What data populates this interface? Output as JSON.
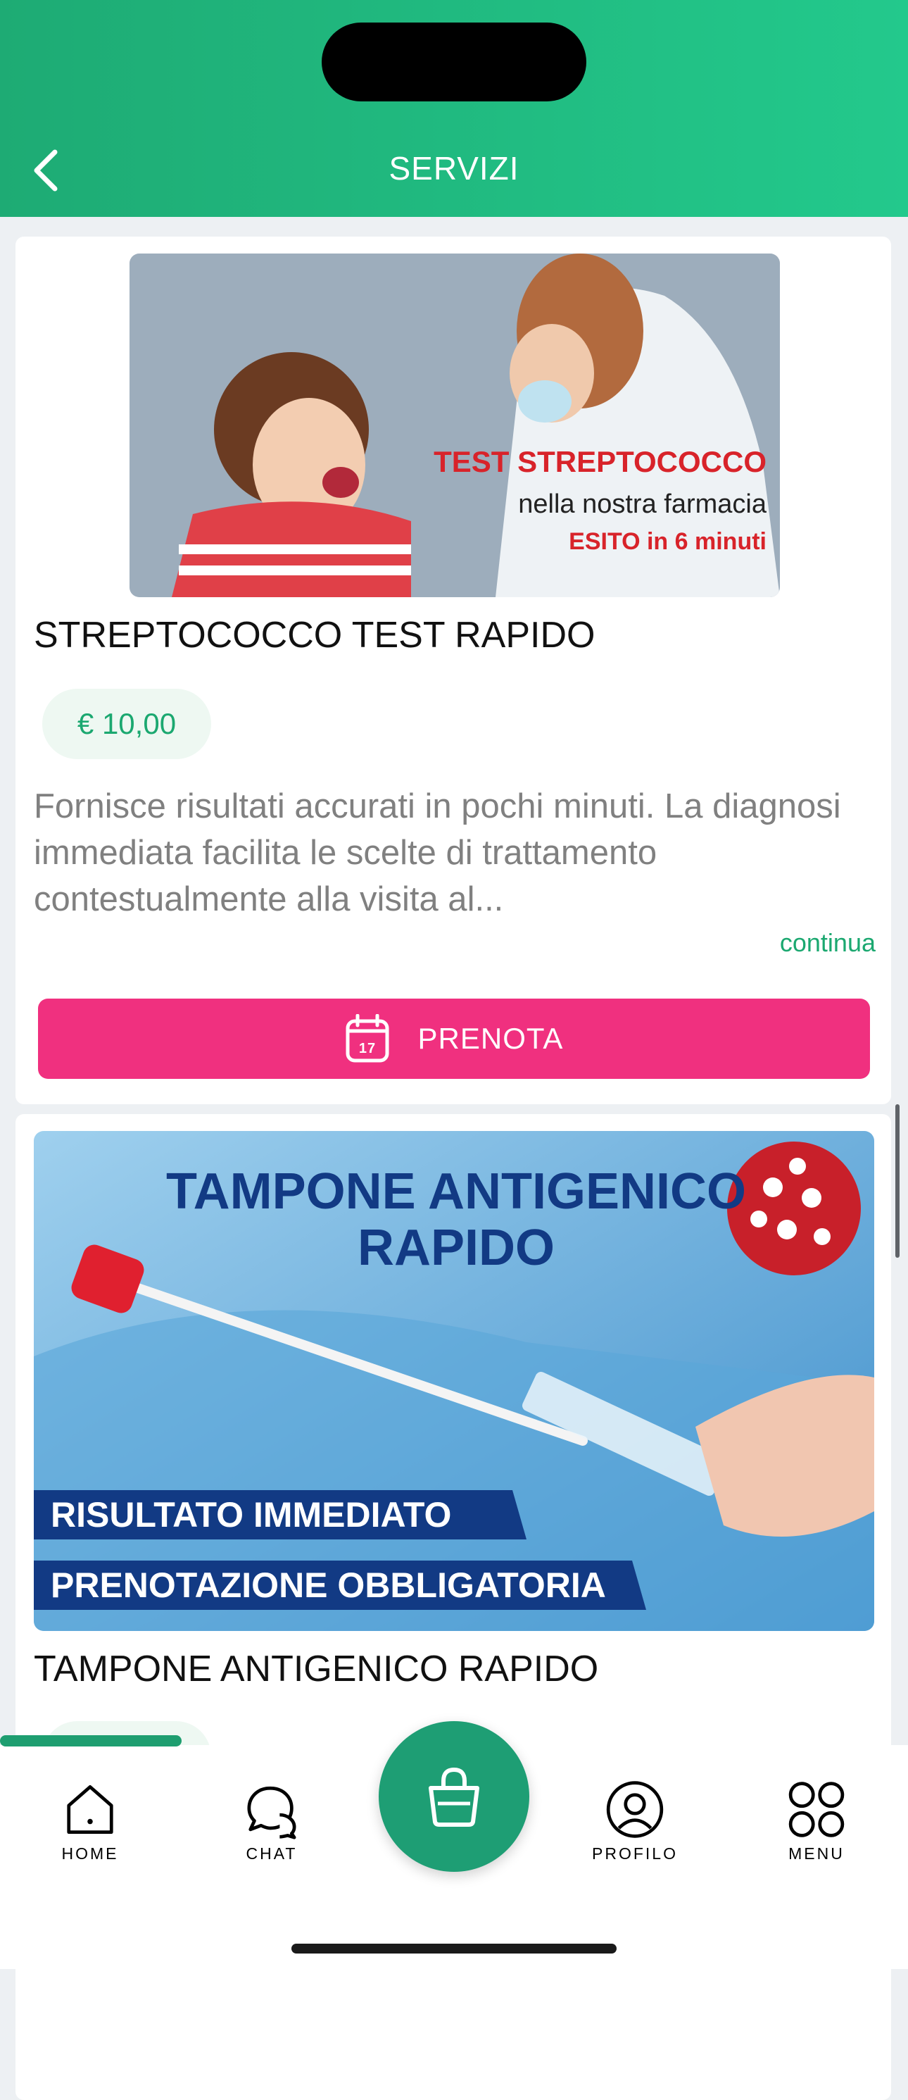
{
  "header": {
    "title": "SERVIZI",
    "back_icon": "chevron-left-icon"
  },
  "services": [
    {
      "title": "STREPTOCOCCO TEST RAPIDO",
      "price": "€ 10,00",
      "description": "Fornisce risultati accurati in pochi minuti. La diagnosi immediata facilita le scelte di trattamento contestualmente alla visita al...",
      "continue_label": "continua",
      "book_label": "PRENOTA",
      "image_text": [
        "TEST STREPTOCOCCO",
        "nella nostra farmacia",
        "ESITO in 6 minuti"
      ]
    },
    {
      "title": "TAMPONE ANTIGENICO RAPIDO",
      "image_text": [
        "TAMPONE ANTIGENICO",
        "RAPIDO",
        "RISULTATO IMMEDIATO",
        "PRENOTAZIONE OBBLIGATORIA"
      ]
    }
  ],
  "tabbar": {
    "home": "HOME",
    "chat": "CHAT",
    "profile": "PROFILO",
    "menu": "MENU"
  },
  "colors": {
    "brand_green": "#1eab74",
    "book_pink": "#f0307f"
  }
}
